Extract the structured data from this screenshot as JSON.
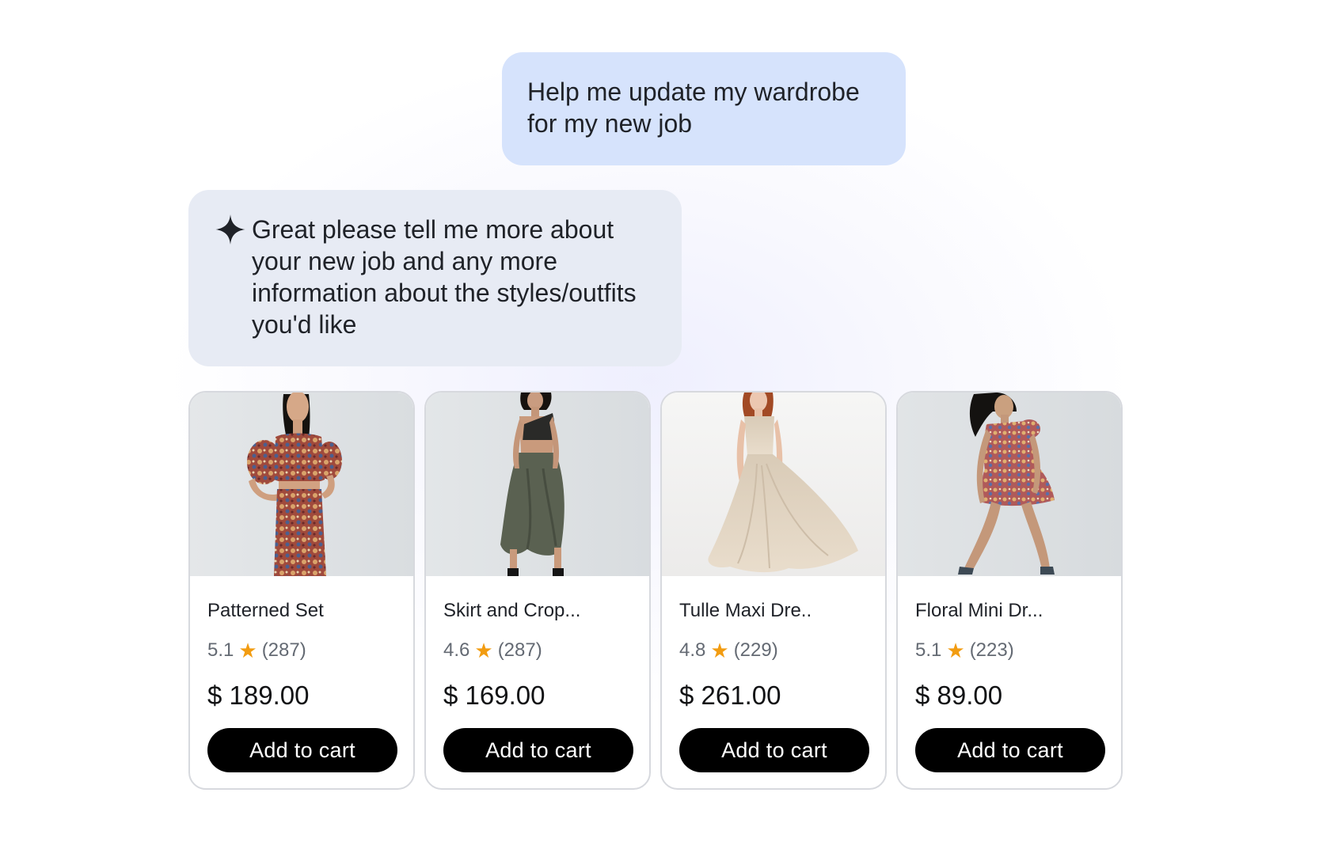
{
  "conversation": {
    "user_message": "Help me update my wardrobe for my new job",
    "assistant_message": "Great please tell me more about your new job and any more information about the styles/outfits you'd like",
    "assistant_icon": "sparkle-icon"
  },
  "products": [
    {
      "name": "Patterned Set",
      "rating": "5.1",
      "reviews": "(287)",
      "price": "$ 189.00",
      "button_label": "Add to cart",
      "image": "model in paisley-patterned crop top and skirt"
    },
    {
      "name": "Skirt and Crop...",
      "rating": "4.6",
      "reviews": "(287)",
      "price": "$ 169.00",
      "button_label": "Add to cart",
      "image": "model in black leather crop top and olive draped skirt"
    },
    {
      "name": "Tulle Maxi Dre..",
      "rating": "4.8",
      "reviews": "(229)",
      "price": "$ 261.00",
      "button_label": "Add to cart",
      "image": "model in flowing beige tulle maxi dress"
    },
    {
      "name": "Floral Mini Dr...",
      "rating": "5.1",
      "reviews": "(223)",
      "price": "$ 89.00",
      "button_label": "Add to cart",
      "image": "model in patterned floral mini dress"
    }
  ],
  "colors": {
    "user_bubble": "#d6e3fc",
    "assistant_bubble": "#e7ebf4",
    "star": "#f29c11",
    "button": "#000000"
  }
}
